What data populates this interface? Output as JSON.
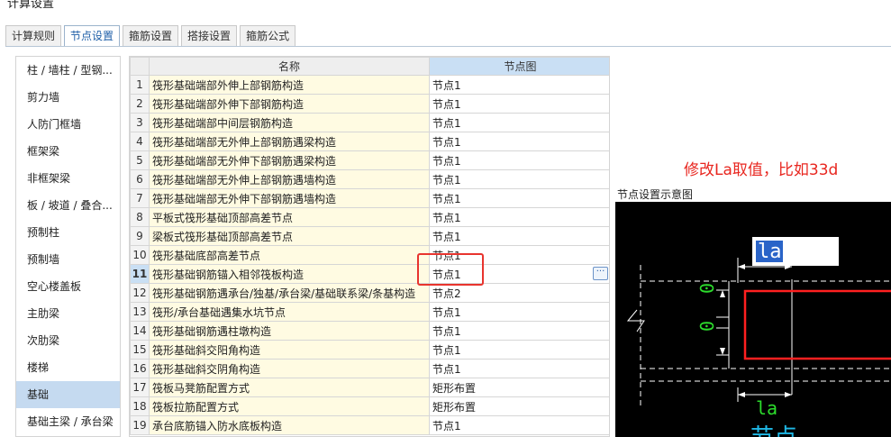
{
  "window": {
    "title": "计算设置"
  },
  "tabs": [
    {
      "label": "计算规则",
      "active": false
    },
    {
      "label": "节点设置",
      "active": true
    },
    {
      "label": "箍筋设置",
      "active": false
    },
    {
      "label": "搭接设置",
      "active": false
    },
    {
      "label": "箍筋公式",
      "active": false
    }
  ],
  "sidebar": {
    "items": [
      {
        "label": "柱 / 墙柱 / 型钢..."
      },
      {
        "label": "剪力墙"
      },
      {
        "label": "人防门框墙"
      },
      {
        "label": "框架梁"
      },
      {
        "label": "非框架梁"
      },
      {
        "label": "板 / 坡道 / 叠合..."
      },
      {
        "label": "预制柱"
      },
      {
        "label": "预制墙"
      },
      {
        "label": "空心楼盖板"
      },
      {
        "label": "主肋梁"
      },
      {
        "label": "次肋梁"
      },
      {
        "label": "楼梯"
      },
      {
        "label": "基础",
        "active": true
      },
      {
        "label": "基础主梁 / 承台梁"
      }
    ]
  },
  "grid": {
    "headers": {
      "name": "名称",
      "node": "节点图"
    },
    "rows": [
      {
        "idx": "1",
        "name": "筏形基础端部外伸上部钢筋构造",
        "node": "节点1"
      },
      {
        "idx": "2",
        "name": "筏形基础端部外伸下部钢筋构造",
        "node": "节点1"
      },
      {
        "idx": "3",
        "name": "筏形基础端部中间层钢筋构造",
        "node": "节点1"
      },
      {
        "idx": "4",
        "name": "筏形基础端部无外伸上部钢筋遇梁构造",
        "node": "节点1"
      },
      {
        "idx": "5",
        "name": "筏形基础端部无外伸下部钢筋遇梁构造",
        "node": "节点1"
      },
      {
        "idx": "6",
        "name": "筏形基础端部无外伸上部钢筋遇墙构造",
        "node": "节点1"
      },
      {
        "idx": "7",
        "name": "筏形基础端部无外伸下部钢筋遇墙构造",
        "node": "节点1"
      },
      {
        "idx": "8",
        "name": "平板式筏形基础顶部高差节点",
        "node": "节点1"
      },
      {
        "idx": "9",
        "name": "梁板式筏形基础顶部高差节点",
        "node": "节点1"
      },
      {
        "idx": "10",
        "name": "筏形基础底部高差节点",
        "node": "节点1"
      },
      {
        "idx": "11",
        "name": "筏形基础钢筋锚入相邻筏板构造",
        "node": "节点1",
        "selected": true
      },
      {
        "idx": "12",
        "name": "筏形基础钢筋遇承台/独基/承台梁/基础联系梁/条基构造",
        "node": "节点2"
      },
      {
        "idx": "13",
        "name": "筏形/承台基础遇集水坑节点",
        "node": "节点1"
      },
      {
        "idx": "14",
        "name": "筏形基础钢筋遇柱墩构造",
        "node": "节点1"
      },
      {
        "idx": "15",
        "name": "筏形基础斜交阳角构造",
        "node": "节点1"
      },
      {
        "idx": "16",
        "name": "筏形基础斜交阴角构造",
        "node": "节点1"
      },
      {
        "idx": "17",
        "name": "筏板马凳筋配置方式",
        "node": "矩形布置"
      },
      {
        "idx": "18",
        "name": "筏板拉筋配置方式",
        "node": "矩形布置"
      },
      {
        "idx": "19",
        "name": "承台底筋锚入防水底板构造",
        "node": "节点1"
      }
    ],
    "ellipsis_label": "···"
  },
  "annotation": {
    "text": "修改La取值，比如33d"
  },
  "preview": {
    "title": "节点设置示意图",
    "top_label": "la",
    "bottom_label": "la",
    "dim_text_1": "0",
    "dim_text_2": "0",
    "caption": "节点"
  },
  "colors": {
    "highlight": "#e8342e",
    "annotation": "#e8261f",
    "selected_tab": "#1f5fa8",
    "preview_bg": "#000000",
    "red_line": "#ff2020",
    "green_text": "#2cdc2c",
    "cyan_text": "#1fb8e6"
  }
}
